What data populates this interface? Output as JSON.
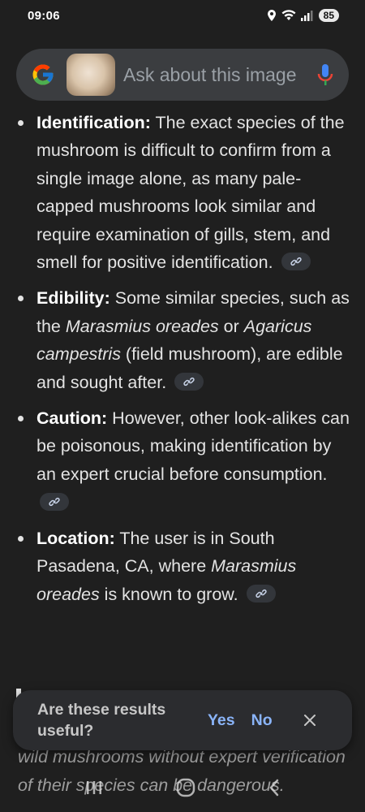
{
  "status": {
    "time": "09:06",
    "battery": "85"
  },
  "search": {
    "placeholder": "Ask about this image"
  },
  "items": [
    {
      "label": "Identification:",
      "text": " The exact species of the mushroom is difficult to confirm from a single image alone, as many pale-capped mushrooms look similar and require examination of gills, stem, and smell for positive identification."
    },
    {
      "label": "Edibility:",
      "text1": " Some similar species, such as the ",
      "italic1": "Marasmius oreades",
      "text2": " or ",
      "italic2": "Agaricus campestris",
      "text3": " (field mushroom), are edible and sought after."
    },
    {
      "label": "Caution:",
      "text": " However, other look-alikes can be poisonous, making identification by an expert crucial before consumption."
    },
    {
      "label": "Location:",
      "text1": " The user is in South Pasadena, CA, where ",
      "italic1": "Marasmius oreades",
      "text2": " is known to grow."
    }
  ],
  "feedback": {
    "question": "Are these results useful?",
    "yes": "Yes",
    "no": "No"
  },
  "below": {
    "text": "wild mushrooms without expert verification of their species can be dangerous."
  },
  "colors": {
    "background": "#1f1f1f",
    "accent": "#8ab4f8"
  }
}
